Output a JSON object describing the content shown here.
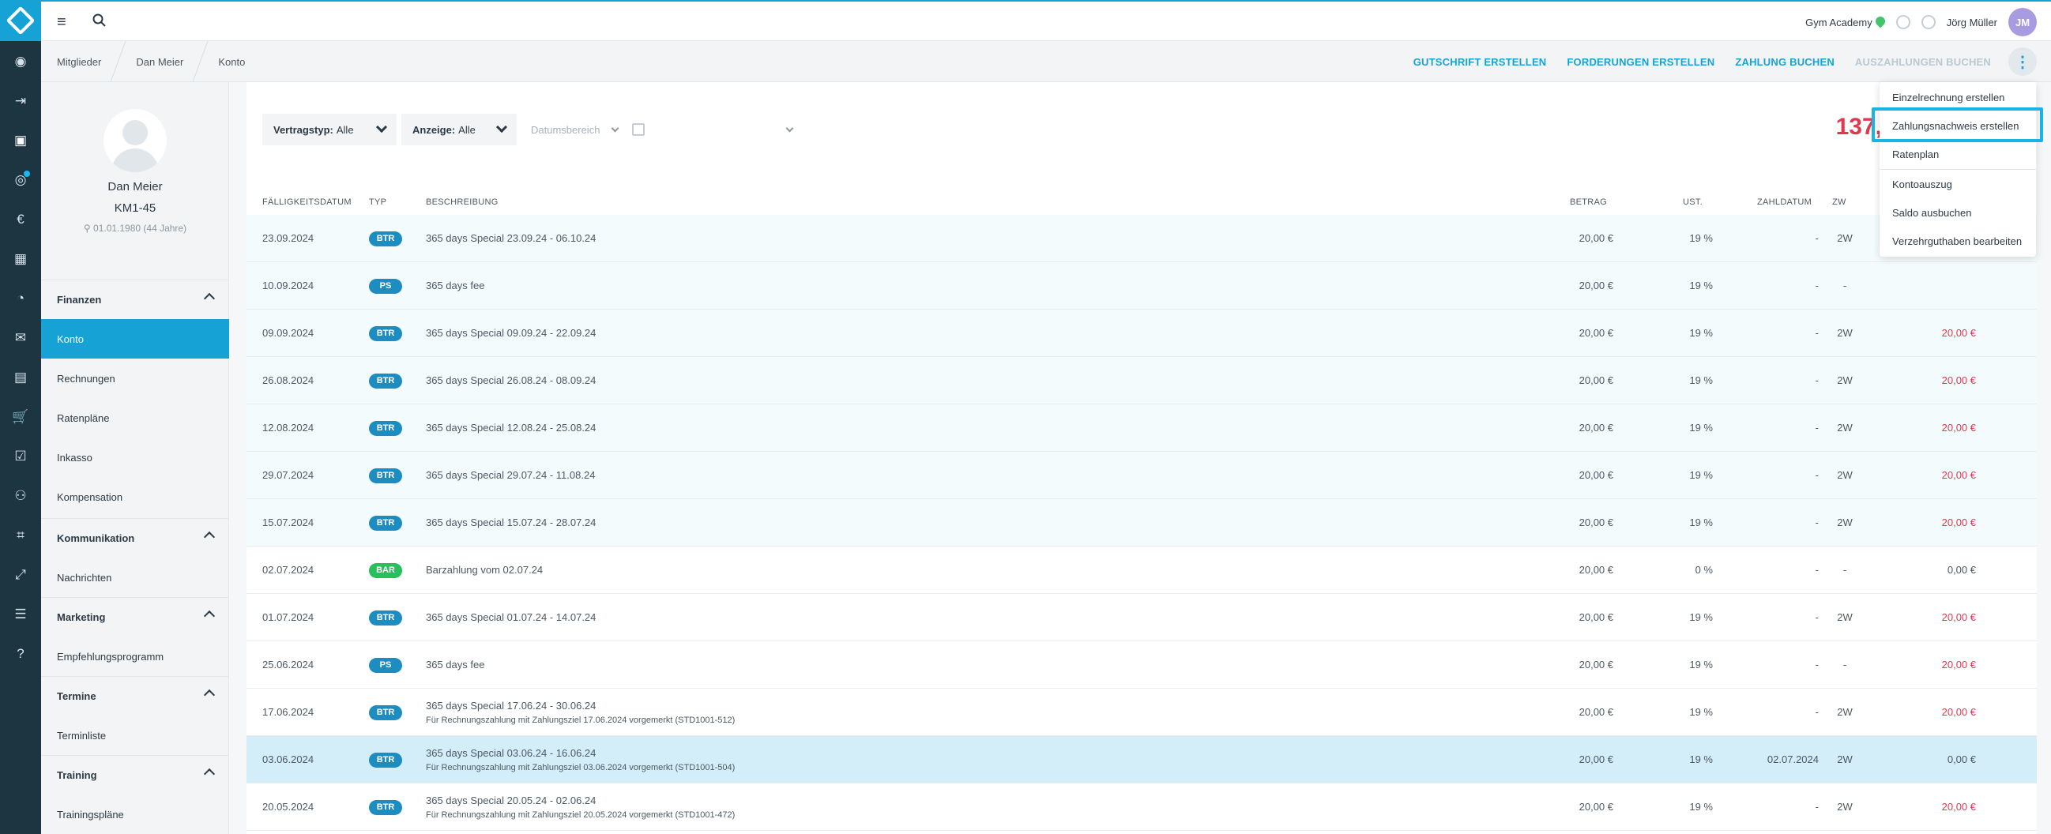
{
  "topbar": {
    "studio": "Gym Academy",
    "user_name": "Jörg Müller",
    "user_initials": "JM"
  },
  "breadcrumb": [
    "Mitglieder",
    "Dan Meier",
    "Konto"
  ],
  "actions": {
    "gutschrift": "GUTSCHRIFT ERSTELLEN",
    "forderungen": "FORDERUNGEN ERSTELLEN",
    "zahlung": "ZAHLUNG BUCHEN",
    "auszahlungen": "AUSZAHLUNGEN BUCHEN"
  },
  "profile": {
    "name": "Dan Meier",
    "member_id": "KM1-45",
    "birth": "01.01.1980 (44 Jahre)"
  },
  "nav": {
    "finanzen": "Finanzen",
    "konto": "Konto",
    "rechnungen": "Rechnungen",
    "ratenplaene": "Ratenpläne",
    "inkasso": "Inkasso",
    "kompensation": "Kompensation",
    "kommunikation": "Kommunikation",
    "nachrichten": "Nachrichten",
    "marketing": "Marketing",
    "empfehlung": "Empfehlungsprogramm",
    "termine": "Termine",
    "terminliste": "Terminliste",
    "training": "Training",
    "trainingsplaene": "Trainingspläne"
  },
  "filters": {
    "vertragstyp_label": "Vertragstyp:",
    "vertragstyp_value": "Alle",
    "anzeige_label": "Anzeige:",
    "anzeige_value": "Alle",
    "date_placeholder": "Datumsbereich"
  },
  "balance": "137,",
  "columns": {
    "faellig": "FÄLLIGKEITSDATUM",
    "typ": "TYP",
    "beschreibung": "BESCHREIBUNG",
    "betrag": "BETRAG",
    "ust": "UST.",
    "zahldatum": "ZAHLDATUM",
    "zw": "ZW"
  },
  "rows": [
    {
      "date": "23.09.2024",
      "type": "BTR",
      "desc": "365 days Special 23.09.24 - 06.10.24",
      "sub": "",
      "amount": "20,00 €",
      "ust": "19 %",
      "paid": "-",
      "zw": "2W",
      "open": "",
      "open_red": false
    },
    {
      "date": "10.09.2024",
      "type": "PS",
      "desc": "365 days fee",
      "sub": "",
      "amount": "20,00 €",
      "ust": "19 %",
      "paid": "-",
      "zw": "-",
      "open": "",
      "open_red": false
    },
    {
      "date": "09.09.2024",
      "type": "BTR",
      "desc": "365 days Special 09.09.24 - 22.09.24",
      "sub": "",
      "amount": "20,00 €",
      "ust": "19 %",
      "paid": "-",
      "zw": "2W",
      "open": "20,00 €",
      "open_red": true
    },
    {
      "date": "26.08.2024",
      "type": "BTR",
      "desc": "365 days Special 26.08.24 - 08.09.24",
      "sub": "",
      "amount": "20,00 €",
      "ust": "19 %",
      "paid": "-",
      "zw": "2W",
      "open": "20,00 €",
      "open_red": true
    },
    {
      "date": "12.08.2024",
      "type": "BTR",
      "desc": "365 days Special 12.08.24 - 25.08.24",
      "sub": "",
      "amount": "20,00 €",
      "ust": "19 %",
      "paid": "-",
      "zw": "2W",
      "open": "20,00 €",
      "open_red": true
    },
    {
      "date": "29.07.2024",
      "type": "BTR",
      "desc": "365 days Special 29.07.24 - 11.08.24",
      "sub": "",
      "amount": "20,00 €",
      "ust": "19 %",
      "paid": "-",
      "zw": "2W",
      "open": "20,00 €",
      "open_red": true
    },
    {
      "date": "15.07.2024",
      "type": "BTR",
      "desc": "365 days Special 15.07.24 - 28.07.24",
      "sub": "",
      "amount": "20,00 €",
      "ust": "19 %",
      "paid": "-",
      "zw": "2W",
      "open": "20,00 €",
      "open_red": true
    },
    {
      "date": "02.07.2024",
      "type": "BAR",
      "desc": "Barzahlung vom 02.07.24",
      "sub": "",
      "amount": "20,00 €",
      "ust": "0 %",
      "paid": "-",
      "zw": "-",
      "open": "0,00 €",
      "open_red": false
    },
    {
      "date": "01.07.2024",
      "type": "BTR",
      "desc": "365 days Special 01.07.24 - 14.07.24",
      "sub": "",
      "amount": "20,00 €",
      "ust": "19 %",
      "paid": "-",
      "zw": "2W",
      "open": "20,00 €",
      "open_red": true
    },
    {
      "date": "25.06.2024",
      "type": "PS",
      "desc": "365 days fee",
      "sub": "",
      "amount": "20,00 €",
      "ust": "19 %",
      "paid": "-",
      "zw": "-",
      "open": "20,00 €",
      "open_red": true
    },
    {
      "date": "17.06.2024",
      "type": "BTR",
      "desc": "365 days Special 17.06.24 - 30.06.24",
      "sub": "Für Rechnungszahlung mit Zahlungsziel 17.06.2024 vorgemerkt (STD1001-512)",
      "amount": "20,00 €",
      "ust": "19 %",
      "paid": "-",
      "zw": "2W",
      "open": "20,00 €",
      "open_red": true
    },
    {
      "date": "03.06.2024",
      "type": "BTR",
      "desc": "365 days Special 03.06.24 - 16.06.24",
      "sub": "Für Rechnungszahlung mit Zahlungsziel 03.06.2024 vorgemerkt (STD1001-504)",
      "amount": "20,00 €",
      "ust": "19 %",
      "paid": "02.07.2024",
      "zw": "2W",
      "open": "0,00 €",
      "open_red": false
    },
    {
      "date": "20.05.2024",
      "type": "BTR",
      "desc": "365 days Special 20.05.24 - 02.06.24",
      "sub": "Für Rechnungszahlung mit Zahlungsziel 20.05.2024 vorgemerkt (STD1001-472)",
      "amount": "20,00 €",
      "ust": "19 %",
      "paid": "-",
      "zw": "2W",
      "open": "20,00 €",
      "open_red": true
    }
  ],
  "dropdown": [
    "Einzelrechnung erstellen",
    "Zahlungsnachweis erstellen",
    "Ratenplan",
    "Kontoauszug",
    "Saldo ausbuchen",
    "Verzehrguthaben bearbeiten"
  ],
  "colors": {
    "accent": "#17a2d6",
    "rail": "#1d3441",
    "negative": "#e2384d",
    "bar_badge": "#27c05d"
  }
}
